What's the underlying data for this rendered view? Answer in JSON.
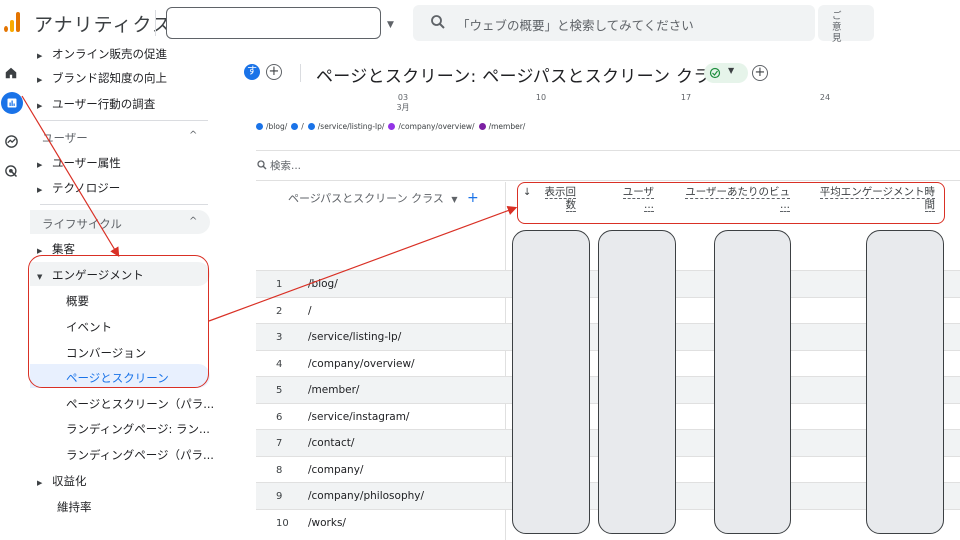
{
  "app": {
    "title": "アナリティクス",
    "search_placeholder": "「ウェブの概要」と検索してみてください",
    "feedback_label": "ご意見"
  },
  "sidebar": {
    "items_top": [
      {
        "label": "オンライン販売の促進"
      },
      {
        "label": "ブランド認知度の向上"
      },
      {
        "label": "ユーザー行動の調査"
      }
    ],
    "section_user": "ユーザー",
    "user_items": [
      {
        "label": "ユーザー属性"
      },
      {
        "label": "テクノロジー"
      }
    ],
    "section_lifecycle": "ライフサイクル",
    "acquisition": "集客",
    "engagement": "エンゲージメント",
    "engagement_children": [
      {
        "label": "概要"
      },
      {
        "label": "イベント"
      },
      {
        "label": "コンバージョン"
      },
      {
        "label": "ページとスクリーン"
      },
      {
        "label": "ページとスクリーン（パラ..."
      },
      {
        "label": "ランディングページ: ラン..."
      },
      {
        "label": "ランディングページ（パラ..."
      }
    ],
    "monetization": "収益化",
    "retention": "維持率"
  },
  "report": {
    "badge": "す",
    "title": "ページとスクリーン: ページパスとスクリーン クラス",
    "dates": [
      {
        "day": "03",
        "month": "3月"
      },
      {
        "day": "10",
        "month": ""
      },
      {
        "day": "17",
        "month": ""
      },
      {
        "day": "24",
        "month": ""
      }
    ],
    "legend": [
      {
        "label": "/blog/",
        "color": "#1a73e8"
      },
      {
        "label": "/",
        "color": "#1a73e8"
      },
      {
        "label": "/service/listing-lp/",
        "color": "#1a73e8"
      },
      {
        "label": "/company/overview/",
        "color": "#9334e6"
      },
      {
        "label": "/member/",
        "color": "#7b1fa2"
      }
    ],
    "table_search_placeholder": "検索...",
    "dimension_header": "ページパスとスクリーン クラス",
    "metric_headers": [
      {
        "line1": "表示回",
        "line2": "数"
      },
      {
        "line1": "ユーザ",
        "line2": "..."
      },
      {
        "line1": "ユーザーあたりのビュ",
        "line2": "..."
      },
      {
        "line1": "平均エンゲージメント時",
        "line2": "間"
      }
    ],
    "rows": [
      {
        "n": "1",
        "path": "/blog/"
      },
      {
        "n": "2",
        "path": "/"
      },
      {
        "n": "3",
        "path": "/service/listing-lp/"
      },
      {
        "n": "4",
        "path": "/company/overview/"
      },
      {
        "n": "5",
        "path": "/member/"
      },
      {
        "n": "6",
        "path": "/service/instagram/"
      },
      {
        "n": "7",
        "path": "/contact/"
      },
      {
        "n": "8",
        "path": "/company/"
      },
      {
        "n": "9",
        "path": "/company/philosophy/"
      },
      {
        "n": "10",
        "path": "/works/"
      }
    ]
  },
  "colors": {
    "accent": "#1a73e8",
    "annotation": "#d93025",
    "logo_orange": "#f9ab00",
    "logo_dark": "#e37400"
  }
}
